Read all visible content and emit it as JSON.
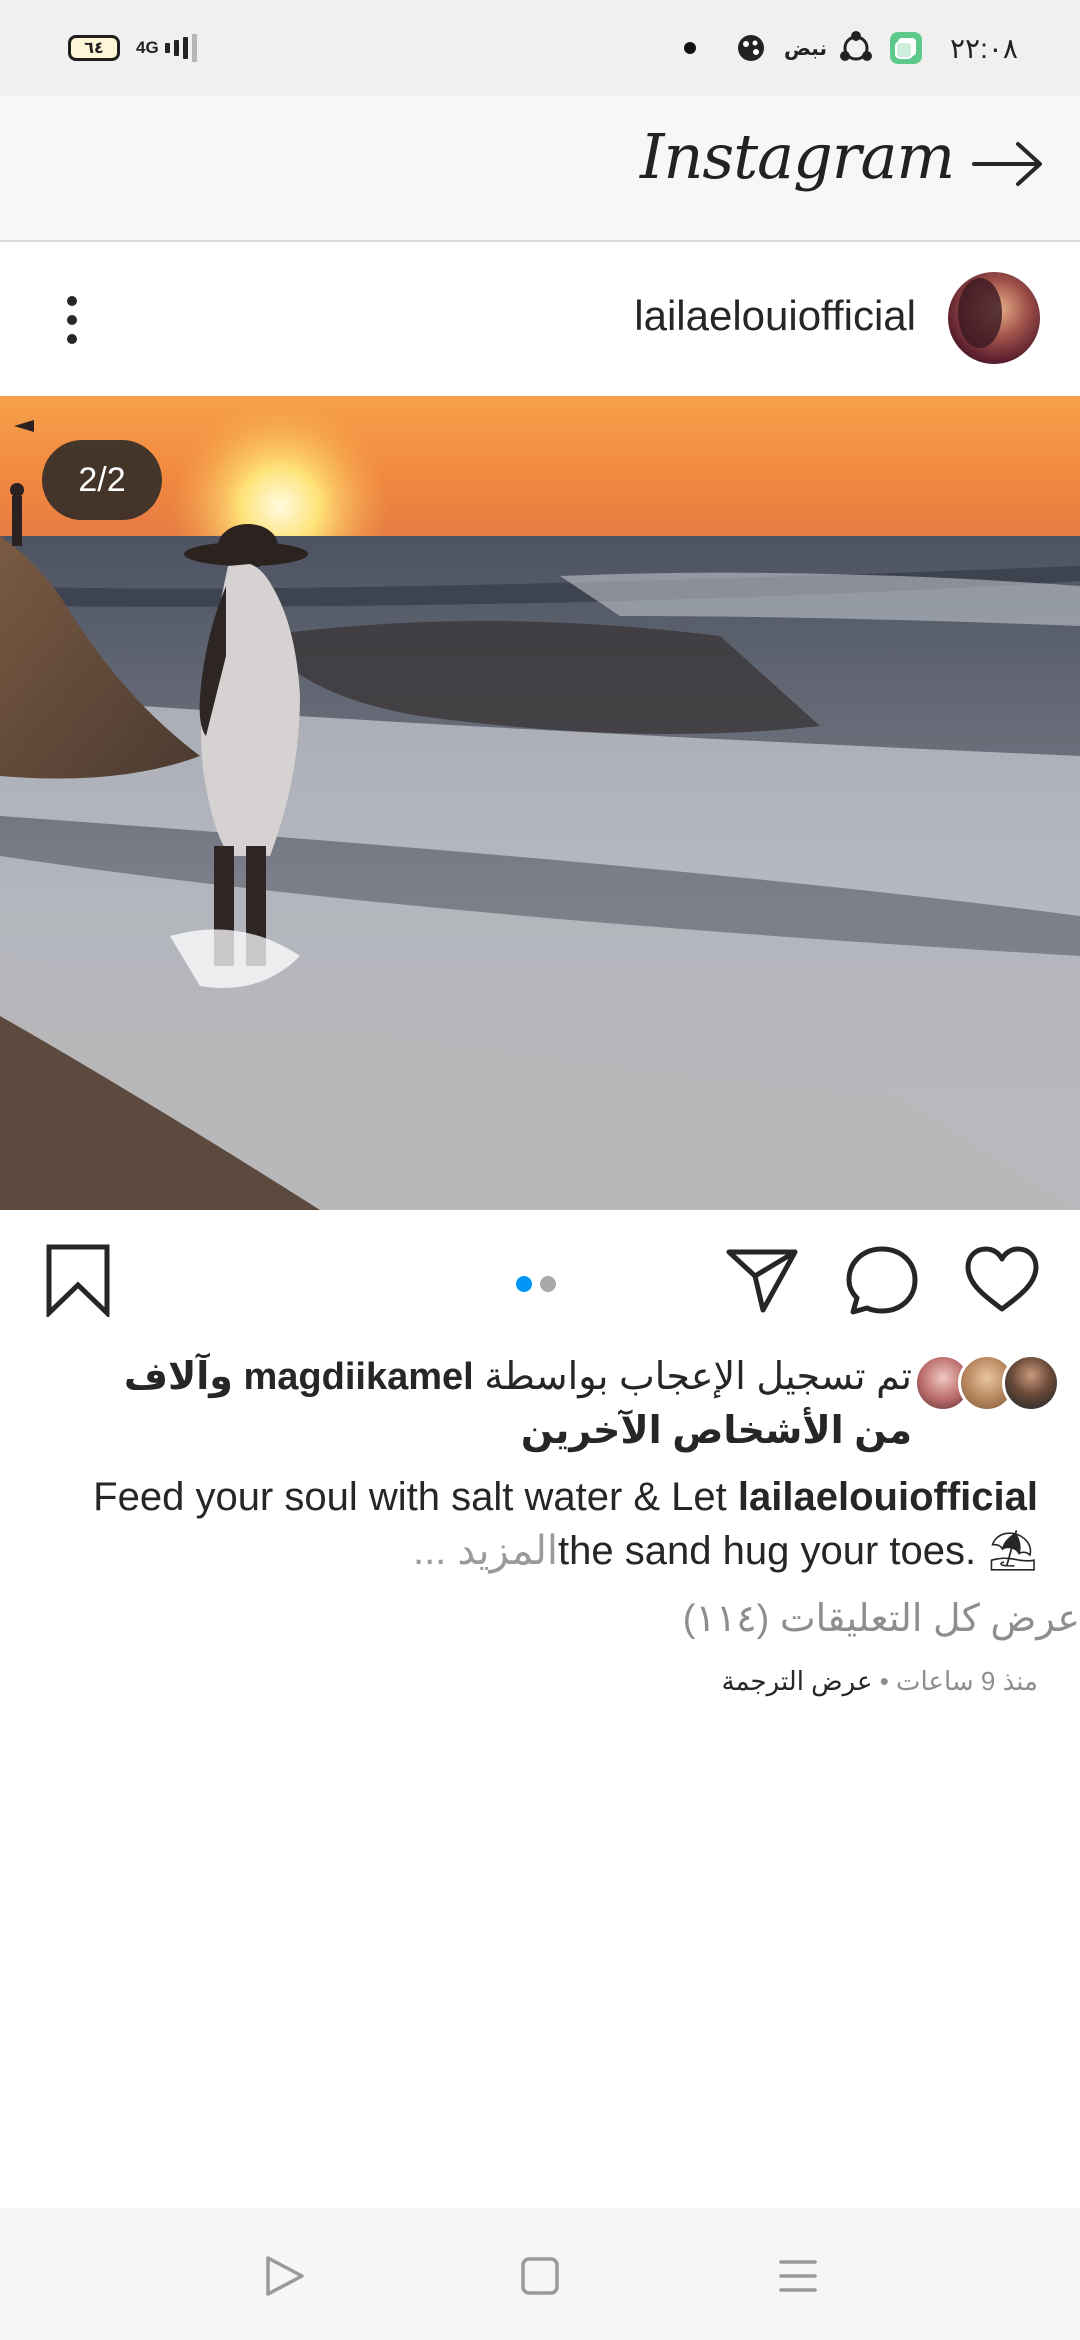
{
  "status_bar": {
    "time": "٢٢:٠٨",
    "battery": "٦٤",
    "network": "4G",
    "pulse_label": "نبض"
  },
  "header": {
    "logo": "Instagram"
  },
  "post": {
    "username": "lailaelouiofficial",
    "counter": "2/2",
    "carousel": {
      "total": 2,
      "active": 2
    },
    "likes": {
      "prefix": "تم تسجيل الإعجاب بواسطة",
      "user": "magdiikamel",
      "suffix": "وآلاف من الأشخاص الآخرين"
    },
    "caption": {
      "username": "lailaelouiofficial",
      "text_line1": "Feed your soul with salt water & Let",
      "text_line2": "the sand hug your toes. ⛱",
      "more": "... المزيد"
    },
    "view_comments": "عرض كل التعليقات (١١٤)",
    "time_ago": "منذ 9 ساعات",
    "separator": " • ",
    "translate": "عرض الترجمة"
  },
  "colors": {
    "accent": "#0095f6",
    "inactive_dot": "#a8a8a8",
    "text": "#262626",
    "muted": "#8e8e8e"
  }
}
